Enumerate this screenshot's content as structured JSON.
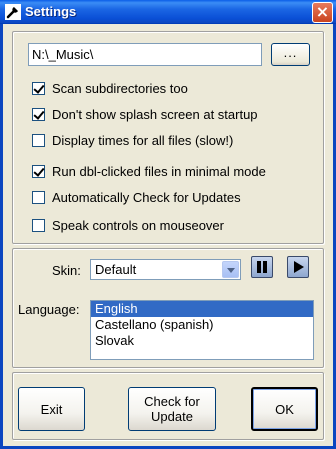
{
  "window": {
    "title": "Settings",
    "title_icon": "wrench-icon",
    "close_label": "×"
  },
  "path": {
    "value": "N:\\_Music\\",
    "browse_label": "..."
  },
  "options": [
    {
      "label": "Scan subdirectories too",
      "checked": true
    },
    {
      "label": "Don't show splash screen at startup",
      "checked": true
    },
    {
      "label": "Display times for all files (slow!)",
      "checked": false
    },
    {
      "label": "Run dbl-clicked files in minimal mode",
      "checked": true
    },
    {
      "label": "Automatically Check for Updates",
      "checked": false
    },
    {
      "label": "Speak controls on mouseover",
      "checked": false
    }
  ],
  "skin": {
    "label": "Skin:",
    "value": "Default"
  },
  "language": {
    "label": "Language:",
    "options": [
      "English",
      "Castellano (spanish)",
      "Slovak"
    ],
    "selected": "English"
  },
  "buttons": {
    "exit": "Exit",
    "check_update": "Check for\nUpdate",
    "check_update_line1": "Check for",
    "check_update_line2": "Update",
    "ok": "OK"
  },
  "colors": {
    "titlebar": "#0a4fd6",
    "face": "#ece9d8",
    "selection": "#316ac5"
  }
}
